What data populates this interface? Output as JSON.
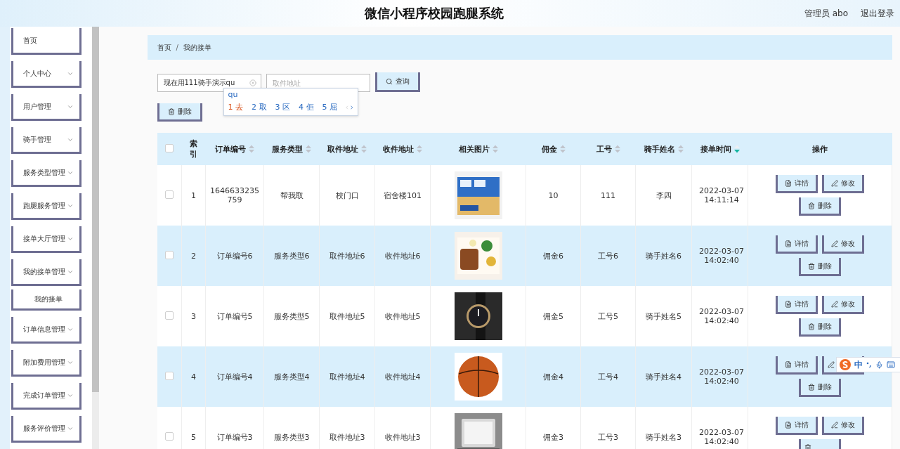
{
  "header": {
    "title": "微信小程序校园跑腿系统",
    "user": "管理员 abo",
    "logout": "退出登录"
  },
  "sidebar": {
    "items": [
      {
        "label": "首页",
        "kind": "link"
      },
      {
        "label": "个人中心",
        "kind": "menu"
      },
      {
        "label": "用户管理",
        "kind": "menu"
      },
      {
        "label": "骑手管理",
        "kind": "menu"
      },
      {
        "label": "服务类型管理",
        "kind": "menu"
      },
      {
        "label": "跑腿服务管理",
        "kind": "menu"
      },
      {
        "label": "接单大厅管理",
        "kind": "menu"
      },
      {
        "label": "我的接单管理",
        "kind": "menu",
        "children": [
          {
            "label": "我的接单"
          }
        ]
      },
      {
        "label": "订单信息管理",
        "kind": "menu"
      },
      {
        "label": "附加费用管理",
        "kind": "menu"
      },
      {
        "label": "完成订单管理",
        "kind": "menu"
      },
      {
        "label": "服务评价管理",
        "kind": "menu"
      }
    ]
  },
  "breadcrumb": {
    "items": [
      "首页",
      "我的接单"
    ],
    "separator": "/"
  },
  "search": {
    "value": "现在用111骑手演示qu",
    "placeholder": "取件地址",
    "button": "查询"
  },
  "ime_popup": {
    "input": "qu",
    "candidates": [
      {
        "number": "1",
        "text": "去",
        "selected": true
      },
      {
        "number": "2",
        "text": "取",
        "selected": false
      },
      {
        "number": "3",
        "text": "区",
        "selected": false
      },
      {
        "number": "4",
        "text": "佢",
        "selected": false
      },
      {
        "number": "5",
        "text": "屈",
        "selected": false
      }
    ]
  },
  "delete_button": "删除",
  "table": {
    "header_checked": false,
    "columns": [
      {
        "label": "索引"
      },
      {
        "label": "订单编号",
        "sortable": true,
        "sort_active": false
      },
      {
        "label": "服务类型",
        "sortable": true,
        "sort_active": false
      },
      {
        "label": "取件地址",
        "sortable": true,
        "sort_active": false
      },
      {
        "label": "收件地址",
        "sortable": true,
        "sort_active": false
      },
      {
        "label": "相关图片",
        "sortable": true,
        "sort_active": false
      },
      {
        "label": "佣金",
        "sortable": true,
        "sort_active": false
      },
      {
        "label": "工号",
        "sortable": true,
        "sort_active": false
      },
      {
        "label": "骑手姓名",
        "sortable": true,
        "sort_active": false
      },
      {
        "label": "接单时间",
        "sortable": true,
        "sort_active": true
      },
      {
        "label": "操作"
      }
    ],
    "rows": [
      {
        "checked": false,
        "index": "1",
        "order": "1646633235759",
        "service": "帮我取",
        "pickup": "校门口",
        "recv": "宿舍楼101",
        "commission": "10",
        "worker_no": "111",
        "rider": "李四",
        "time": "2022-03-07 14:11:14",
        "actions": [
          {
            "kind": "detail",
            "label": "详情"
          },
          {
            "kind": "edit",
            "label": "修改"
          },
          {
            "kind": "delete",
            "label": "删除"
          }
        ]
      },
      {
        "checked": false,
        "index": "2",
        "order": "订单编号6",
        "service": "服务类型6",
        "pickup": "取件地址6",
        "recv": "收件地址6",
        "commission": "佣金6",
        "worker_no": "工号6",
        "rider": "骑手姓名6",
        "time": "2022-03-07 14:02:40",
        "actions": [
          {
            "kind": "detail",
            "label": "详情"
          },
          {
            "kind": "edit",
            "label": "修改"
          },
          {
            "kind": "delete",
            "label": "删除"
          }
        ]
      },
      {
        "checked": false,
        "index": "3",
        "order": "订单编号5",
        "service": "服务类型5",
        "pickup": "取件地址5",
        "recv": "收件地址5",
        "commission": "佣金5",
        "worker_no": "工号5",
        "rider": "骑手姓名5",
        "time": "2022-03-07 14:02:40",
        "actions": [
          {
            "kind": "detail",
            "label": "详情"
          },
          {
            "kind": "edit",
            "label": "修改"
          },
          {
            "kind": "delete",
            "label": "删除"
          }
        ]
      },
      {
        "checked": false,
        "index": "4",
        "order": "订单编号4",
        "service": "服务类型4",
        "pickup": "取件地址4",
        "recv": "收件地址4",
        "commission": "佣金4",
        "worker_no": "工号4",
        "rider": "骑手姓名4",
        "time": "2022-03-07 14:02:40",
        "actions": [
          {
            "kind": "detail",
            "label": "详情"
          },
          {
            "kind": "edit"
          },
          {
            "kind": "delete",
            "label": "删除"
          }
        ]
      },
      {
        "checked": false,
        "index": "5",
        "order": "订单编号3",
        "service": "服务类型3",
        "pickup": "取件地址3",
        "recv": "收件地址3",
        "commission": "佣金3",
        "worker_no": "工号3",
        "rider": "骑手姓名3",
        "time": "2022-03-07 14:02:40",
        "actions": [
          {
            "kind": "detail",
            "label": "详情"
          },
          {
            "kind": "edit",
            "label": "修改"
          },
          {
            "kind": "delete"
          }
        ]
      }
    ]
  },
  "ime_toolbar": {
    "mode": "中"
  }
}
